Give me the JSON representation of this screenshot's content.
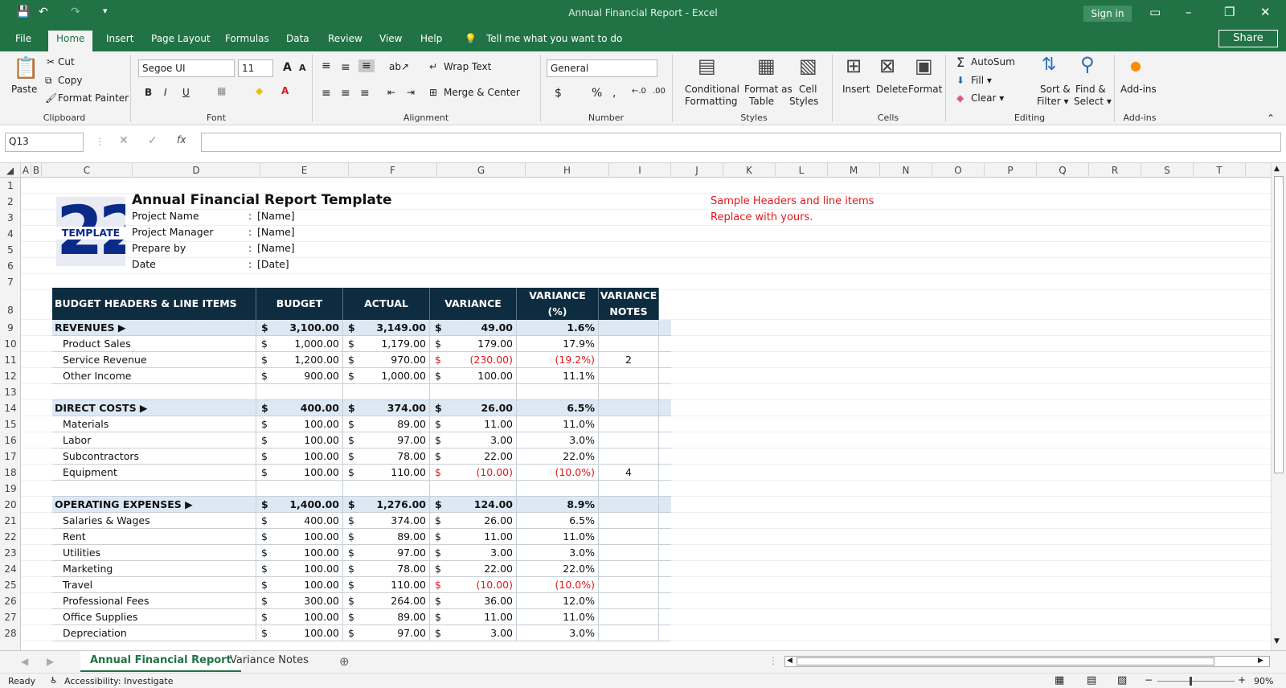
{
  "window": {
    "title": "Annual Financial Report  -  Excel",
    "sign_in": "Sign in"
  },
  "tabs": [
    "File",
    "Home",
    "Insert",
    "Page Layout",
    "Formulas",
    "Data",
    "Review",
    "View",
    "Help"
  ],
  "tell_me": "Tell me what you want to do",
  "share": "Share",
  "ribbon": {
    "clipboard": {
      "paste": "Paste",
      "cut": "Cut",
      "copy": "Copy",
      "format_painter": "Format Painter",
      "label": "Clipboard"
    },
    "font": {
      "name": "Segoe UI",
      "size": "11",
      "label": "Font"
    },
    "alignment": {
      "wrap": "Wrap Text",
      "merge": "Merge & Center",
      "label": "Alignment"
    },
    "number": {
      "format": "General",
      "label": "Number"
    },
    "styles": {
      "cond1": "Conditional",
      "cond2": "Formatting",
      "fat1": "Format as",
      "fat2": "Table",
      "cs1": "Cell",
      "cs2": "Styles",
      "label": "Styles"
    },
    "cells": {
      "insert": "Insert",
      "delete": "Delete",
      "format": "Format",
      "label": "Cells"
    },
    "editing": {
      "autosum": "AutoSum",
      "fill": "Fill",
      "clear": "Clear",
      "sort1": "Sort &",
      "sort2": "Filter",
      "find1": "Find &",
      "find2": "Select",
      "label": "Editing"
    },
    "addins": {
      "btn": "Add-ins",
      "label": "Add-ins"
    }
  },
  "namebox": "Q13",
  "columns": [
    "A",
    "B",
    "C",
    "D",
    "E",
    "F",
    "G",
    "H",
    "I",
    "J",
    "K",
    "L",
    "M",
    "N",
    "O",
    "P",
    "Q",
    "R",
    "S",
    "T"
  ],
  "rows": [
    "1",
    "2",
    "3",
    "4",
    "5",
    "6",
    "7",
    "8",
    "9",
    "10",
    "11",
    "12",
    "13",
    "14",
    "15",
    "16",
    "17",
    "18",
    "19",
    "20",
    "21",
    "22",
    "23",
    "24",
    "25",
    "26",
    "27",
    "28"
  ],
  "logo": {
    "number": "22",
    "word": "TEMPLATE"
  },
  "report": {
    "title": "Annual Financial Report Template",
    "fields": [
      {
        "label": "Project Name",
        "sep": ":",
        "value": "[Name]"
      },
      {
        "label": "Project Manager",
        "sep": ":",
        "value": "[Name]"
      },
      {
        "label": "Prepare by",
        "sep": ":",
        "value": "[Name]"
      },
      {
        "label": "Date",
        "sep": ":",
        "value": "[Date]"
      }
    ],
    "note1": "Sample Headers and line items",
    "note2": "Replace with yours."
  },
  "table": {
    "headers": [
      "BUDGET HEADERS & LINE ITEMS",
      "BUDGET",
      "ACTUAL",
      "VARIANCE",
      "VARIANCE (%)",
      "VARIANCE NOTES"
    ],
    "rows": [
      {
        "name": "REVENUES ▶",
        "sec": true,
        "budget": "3,100.00",
        "actual": "3,149.00",
        "variance": "49.00",
        "pct": "1.6%",
        "notes": "",
        "neg": false
      },
      {
        "name": "Product Sales",
        "sec": false,
        "budget": "1,000.00",
        "actual": "1,179.00",
        "variance": "179.00",
        "pct": "17.9%",
        "notes": "",
        "neg": false
      },
      {
        "name": "Service Revenue",
        "sec": false,
        "budget": "1,200.00",
        "actual": "970.00",
        "variance": "(230.00)",
        "pct": "(19.2%)",
        "notes": "2",
        "neg": true
      },
      {
        "name": "Other Income",
        "sec": false,
        "budget": "900.00",
        "actual": "1,000.00",
        "variance": "100.00",
        "pct": "11.1%",
        "notes": "",
        "neg": false
      },
      {
        "name": "",
        "sec": false,
        "blank": true
      },
      {
        "name": "DIRECT COSTS ▶",
        "sec": true,
        "budget": "400.00",
        "actual": "374.00",
        "variance": "26.00",
        "pct": "6.5%",
        "notes": "",
        "neg": false
      },
      {
        "name": "Materials",
        "sec": false,
        "budget": "100.00",
        "actual": "89.00",
        "variance": "11.00",
        "pct": "11.0%",
        "notes": "",
        "neg": false
      },
      {
        "name": "Labor",
        "sec": false,
        "budget": "100.00",
        "actual": "97.00",
        "variance": "3.00",
        "pct": "3.0%",
        "notes": "",
        "neg": false
      },
      {
        "name": "Subcontractors",
        "sec": false,
        "budget": "100.00",
        "actual": "78.00",
        "variance": "22.00",
        "pct": "22.0%",
        "notes": "",
        "neg": false
      },
      {
        "name": "Equipment",
        "sec": false,
        "budget": "100.00",
        "actual": "110.00",
        "variance": "(10.00)",
        "pct": "(10.0%)",
        "notes": "4",
        "neg": true
      },
      {
        "name": "",
        "sec": false,
        "blank": true
      },
      {
        "name": "OPERATING EXPENSES ▶",
        "sec": true,
        "budget": "1,400.00",
        "actual": "1,276.00",
        "variance": "124.00",
        "pct": "8.9%",
        "notes": "",
        "neg": false
      },
      {
        "name": "Salaries & Wages",
        "sec": false,
        "budget": "400.00",
        "actual": "374.00",
        "variance": "26.00",
        "pct": "6.5%",
        "notes": "",
        "neg": false
      },
      {
        "name": "Rent",
        "sec": false,
        "budget": "100.00",
        "actual": "89.00",
        "variance": "11.00",
        "pct": "11.0%",
        "notes": "",
        "neg": false
      },
      {
        "name": "Utilities",
        "sec": false,
        "budget": "100.00",
        "actual": "97.00",
        "variance": "3.00",
        "pct": "3.0%",
        "notes": "",
        "neg": false
      },
      {
        "name": "Marketing",
        "sec": false,
        "budget": "100.00",
        "actual": "78.00",
        "variance": "22.00",
        "pct": "22.0%",
        "notes": "",
        "neg": false
      },
      {
        "name": "Travel",
        "sec": false,
        "budget": "100.00",
        "actual": "110.00",
        "variance": "(10.00)",
        "pct": "(10.0%)",
        "notes": "",
        "neg": true
      },
      {
        "name": "Professional Fees",
        "sec": false,
        "budget": "300.00",
        "actual": "264.00",
        "variance": "36.00",
        "pct": "12.0%",
        "notes": "",
        "neg": false
      },
      {
        "name": "Office Supplies",
        "sec": false,
        "budget": "100.00",
        "actual": "89.00",
        "variance": "11.00",
        "pct": "11.0%",
        "notes": "",
        "neg": false
      },
      {
        "name": "Depreciation",
        "sec": false,
        "budget": "100.00",
        "actual": "97.00",
        "variance": "3.00",
        "pct": "3.0%",
        "notes": "",
        "neg": false
      }
    ],
    "currency": "$"
  },
  "sheets": [
    "Annual Financial Report",
    "Variance Notes"
  ],
  "status": {
    "ready": "Ready",
    "accessibility": "Accessibility: Investigate",
    "zoom": "90%"
  },
  "colors": {
    "excel_green": "#217346",
    "header_navy": "#0e2c3f",
    "section_blue": "#dce9f5",
    "negative_red": "#e0181b"
  }
}
